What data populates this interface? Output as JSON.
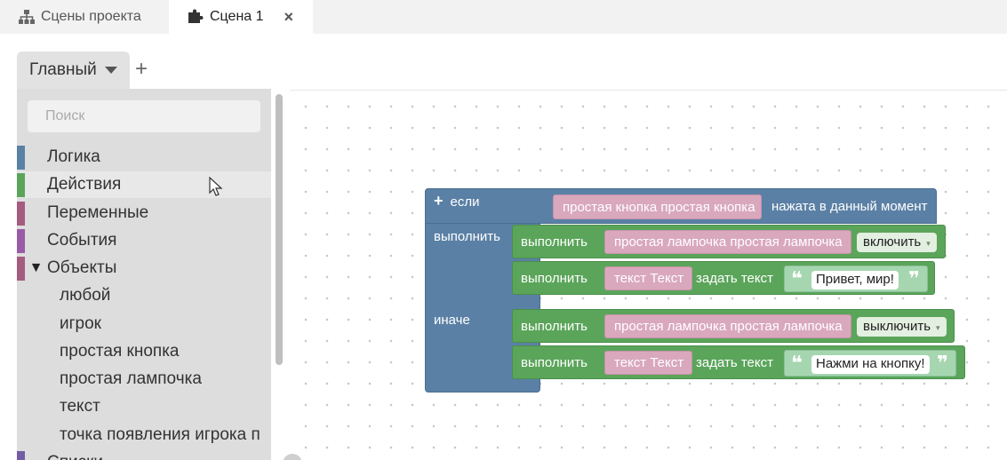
{
  "tabs": [
    {
      "label": "Сцены проекта",
      "icon": "sitemap-icon"
    },
    {
      "label": "Сцена 1",
      "icon": "puzzle-icon",
      "close": "×"
    }
  ],
  "category_tab": {
    "label": "Главный",
    "add": "+"
  },
  "toolbox": {
    "search_placeholder": "Поиск",
    "categories": [
      {
        "label": "Логика",
        "color": "#5b80a5"
      },
      {
        "label": "Действия",
        "color": "#5ba55b"
      },
      {
        "label": "Переменные",
        "color": "#a55b80"
      },
      {
        "label": "События",
        "color": "#995ba5"
      },
      {
        "label": "Объекты",
        "color": "#a55b80",
        "expander": "▼"
      },
      {
        "label": "Списки",
        "color": "#745ba5"
      }
    ],
    "object_items": [
      "любой",
      "игрок",
      "простая кнопка",
      "простая лампочка",
      "текст",
      "точка появления игрока п"
    ]
  },
  "blocks": {
    "if": {
      "plus": "+",
      "if_label": "если",
      "do_label": "выполнить",
      "else_label": "иначе"
    },
    "condition": {
      "object": "простая кнопка простая кнопка",
      "text": "нажата в данный момент"
    },
    "actions": [
      {
        "do": "выполнить",
        "object": "простая лампочка простая лампочка",
        "dropdown": "включить"
      },
      {
        "do": "выполнить",
        "object": "текст Текст",
        "verb": "задать текст",
        "string": "Привет, мир!"
      },
      {
        "do": "выполнить",
        "object": "простая лампочка простая лампочка",
        "dropdown": "выключить"
      },
      {
        "do": "выполнить",
        "object": "текст Текст",
        "verb": "задать текст",
        "string": "Нажми на кнопку!"
      }
    ],
    "quote_open": "❝",
    "quote_close": "❞",
    "dropdown_arrow": "▾"
  }
}
